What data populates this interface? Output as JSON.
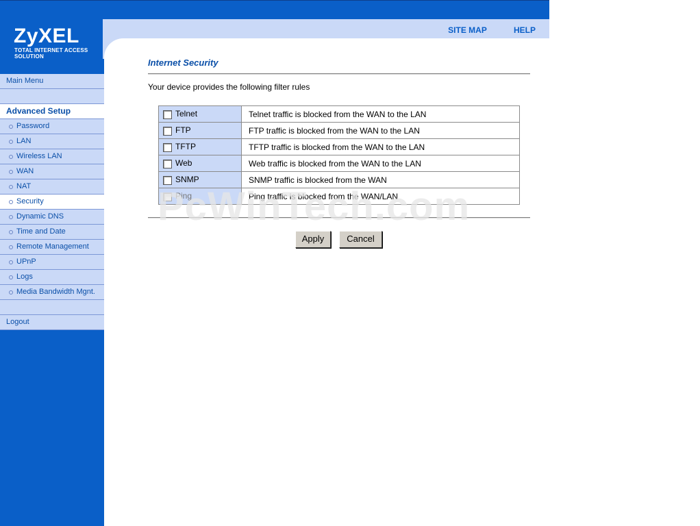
{
  "header": {
    "brand": "ZyXEL",
    "tagline": "TOTAL INTERNET ACCESS SOLUTION",
    "links": [
      "SITE MAP",
      "HELP"
    ]
  },
  "sidebar": {
    "main_menu": "Main Menu",
    "section": "Advanced Setup",
    "items": [
      {
        "label": "Password"
      },
      {
        "label": "LAN"
      },
      {
        "label": "Wireless LAN"
      },
      {
        "label": "WAN"
      },
      {
        "label": "NAT"
      },
      {
        "label": "Security"
      },
      {
        "label": "Dynamic DNS"
      },
      {
        "label": "Time and Date"
      },
      {
        "label": "Remote Management"
      },
      {
        "label": "UPnP"
      },
      {
        "label": "Logs"
      },
      {
        "label": "Media Bandwidth Mgnt."
      }
    ],
    "selected": "Security",
    "logout": "Logout"
  },
  "main": {
    "title": "Internet Security",
    "intro": "Your device provides the following filter rules",
    "rules": [
      {
        "name": "Telnet",
        "desc": "Telnet traffic is blocked from the WAN to the LAN",
        "checked": false,
        "disabled": false
      },
      {
        "name": "FTP",
        "desc": "FTP traffic is blocked from the WAN to the LAN",
        "checked": false,
        "disabled": false
      },
      {
        "name": "TFTP",
        "desc": "TFTP traffic is blocked from the WAN to the LAN",
        "checked": false,
        "disabled": false
      },
      {
        "name": "Web",
        "desc": "Web traffic is blocked from the WAN to the LAN",
        "checked": false,
        "disabled": false
      },
      {
        "name": "SNMP",
        "desc": "SNMP traffic is blocked from the WAN",
        "checked": false,
        "disabled": false
      },
      {
        "name": "Ping",
        "desc": "Ping traffic is blocked from the WAN/LAN",
        "checked": false,
        "disabled": true
      }
    ],
    "apply_label": "Apply",
    "cancel_label": "Cancel"
  },
  "watermark": "PcWinTech.com",
  "colors": {
    "brand_blue": "#0a5fc8",
    "light_blue": "#cad9f7",
    "title_blue": "#0a4fa8"
  }
}
